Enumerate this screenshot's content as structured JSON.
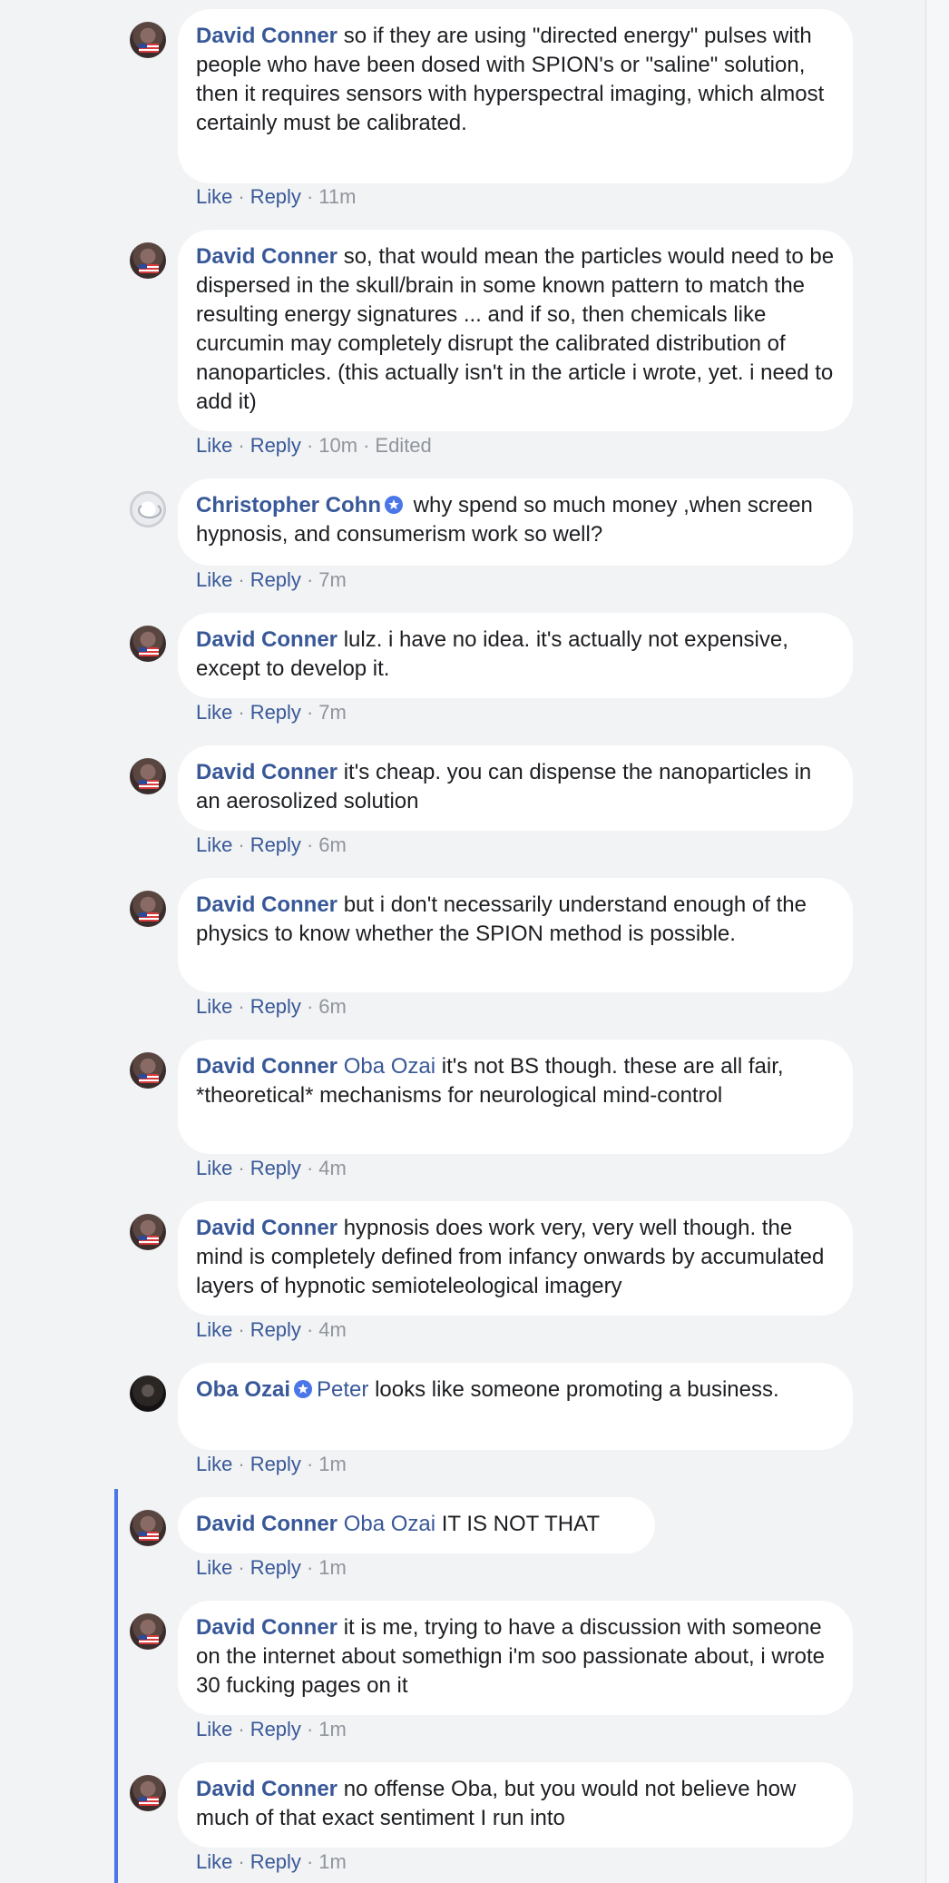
{
  "comments": [
    {
      "author": "David Conner",
      "avatar": "david-conner-avatar",
      "text": "so if they are using \"directed energy\" pulses with people who have been dosed with SPION's or \"saline\" solution, then it requires sensors with hyperspectral imaging, which almost certainly must be calibrated.",
      "like": "Like",
      "reply": "Reply",
      "time": "11m"
    },
    {
      "author": "David Conner",
      "avatar": "david-conner-avatar",
      "text": "so, that would mean the particles would need to be dispersed in the skull/brain in some known pattern to match the resulting energy signatures ... and if so, then chemicals like curcumin may completely disrupt the calibrated distribution of nanoparticles. (this actually isn't in the article i wrote, yet. i need to add it)",
      "like": "Like",
      "reply": "Reply",
      "time": "10m",
      "edited": "Edited"
    },
    {
      "author": "Christopher Cohn",
      "avatar": "christopher-cohn-avatar",
      "badge": "verified-badge-icon",
      "text": "why spend so much money ,when screen hypnosis, and consumerism work so well?",
      "like": "Like",
      "reply": "Reply",
      "time": "7m"
    },
    {
      "author": "David Conner",
      "avatar": "david-conner-avatar",
      "text": "lulz. i have no idea. it's actually not expensive, except to develop it.",
      "like": "Like",
      "reply": "Reply",
      "time": "7m"
    },
    {
      "author": "David Conner",
      "avatar": "david-conner-avatar",
      "text": "it's cheap. you can dispense the nanoparticles in an aerosolized solution",
      "like": "Like",
      "reply": "Reply",
      "time": "6m"
    },
    {
      "author": "David Conner",
      "avatar": "david-conner-avatar",
      "text": "but i don't necessarily understand enough of the physics to know whether the SPION method is possible.",
      "like": "Like",
      "reply": "Reply",
      "time": "6m"
    },
    {
      "author": "David Conner",
      "avatar": "david-conner-avatar",
      "mention": "Oba Ozai",
      "text": "it's not BS though. these are all fair, *theoretical* mechanisms for neurological mind-control",
      "like": "Like",
      "reply": "Reply",
      "time": "4m"
    },
    {
      "author": "David Conner",
      "avatar": "david-conner-avatar",
      "text": "hypnosis does work very, very well though. the mind is completely defined from infancy onwards by accumulated layers of hypnotic semioteleological imagery",
      "like": "Like",
      "reply": "Reply",
      "time": "4m"
    },
    {
      "author": "Oba Ozai",
      "avatar": "oba-ozai-avatar",
      "badge": "verified-badge-icon",
      "mention": "Peter",
      "text": "looks like someone promoting a business.",
      "like": "Like",
      "reply": "Reply",
      "time": "1m"
    },
    {
      "author": "David Conner",
      "avatar": "david-conner-avatar",
      "mention": "Oba Ozai",
      "text": "IT IS NOT THAT",
      "like": "Like",
      "reply": "Reply",
      "time": "1m"
    },
    {
      "author": "David Conner",
      "avatar": "david-conner-avatar",
      "text": "it is me, trying to have a discussion with someone on the internet about somethign i'm soo passionate about, i wrote 30 fucking pages on it",
      "like": "Like",
      "reply": "Reply",
      "time": "1m"
    },
    {
      "author": "David Conner",
      "avatar": "david-conner-avatar",
      "text": "no offense Oba, but you would not believe how much of that exact sentiment I run into",
      "like": "Like",
      "reply": "Reply",
      "time": "1m"
    }
  ],
  "colors": {
    "page_background": "#f2f3f5",
    "bubble_background": "#ffffff",
    "author_link": "#385898",
    "meta_text": "#90949c",
    "thread_line": "#4a76e8"
  }
}
